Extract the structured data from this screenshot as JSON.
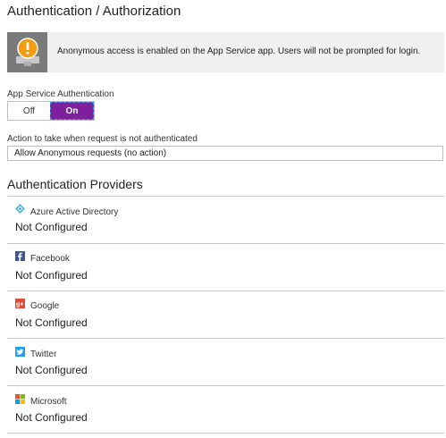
{
  "page": {
    "title": "Authentication / Authorization"
  },
  "warning": {
    "message": "Anonymous access is enabled on the App Service app. Users will not be prompted for login.",
    "icon": "warning-icon",
    "accent": "#f39c12"
  },
  "app_service_auth": {
    "label": "App Service Authentication",
    "off_label": "Off",
    "on_label": "On",
    "selected": "On",
    "on_color": "#7e1f9e"
  },
  "action": {
    "label": "Action to take when request is not authenticated",
    "value": "Allow Anonymous requests (no action)"
  },
  "providers": {
    "title": "Authentication Providers",
    "items": [
      {
        "name": "Azure Active Directory",
        "status": "Not Configured",
        "icon": "azure-ad-icon"
      },
      {
        "name": "Facebook",
        "status": "Not Configured",
        "icon": "facebook-icon"
      },
      {
        "name": "Google",
        "status": "Not Configured",
        "icon": "google-icon"
      },
      {
        "name": "Twitter",
        "status": "Not Configured",
        "icon": "twitter-icon"
      },
      {
        "name": "Microsoft",
        "status": "Not Configured",
        "icon": "microsoft-icon"
      }
    ]
  }
}
